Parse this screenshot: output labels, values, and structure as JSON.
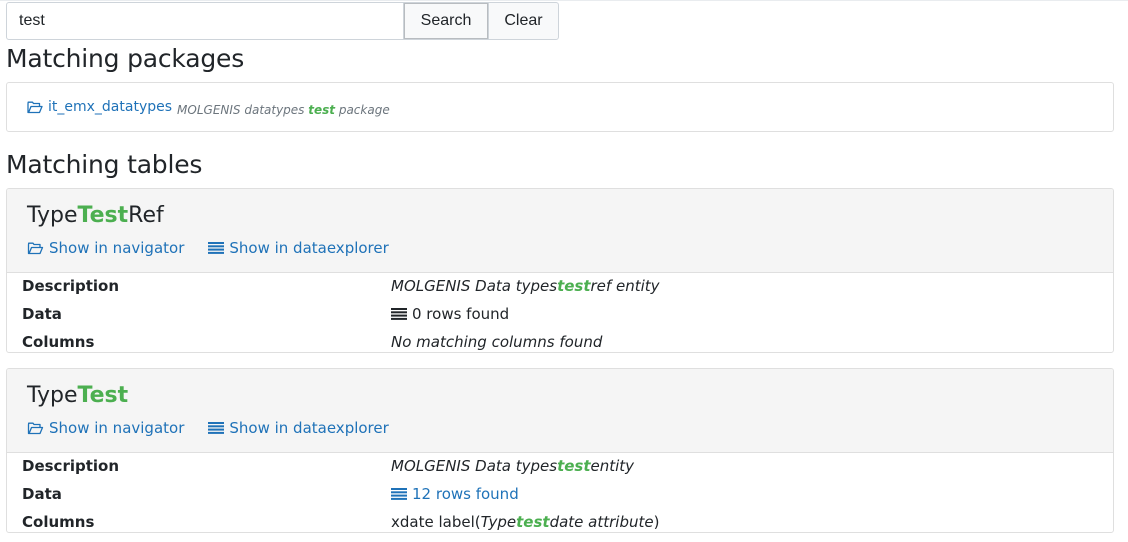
{
  "search": {
    "value": "test",
    "search_label": "Search",
    "clear_label": "Clear"
  },
  "highlight_color": "#4caf50",
  "link_color": "#1f72b8",
  "packages": {
    "title": "Matching packages",
    "items": [
      {
        "name": "it_emx_datatypes",
        "desc_before": "MOLGENIS datatypes ",
        "desc_hl": "test",
        "desc_after": " package",
        "icon": "folder-open-icon"
      }
    ]
  },
  "tables": {
    "title": "Matching tables",
    "show_navigator_label": "Show in navigator",
    "show_dataexplorer_label": "Show in dataexplorer",
    "description_key": "Description",
    "data_key": "Data",
    "columns_key": "Columns",
    "items": [
      {
        "name_before": "Type",
        "name_hl": "Test",
        "name_after": "Ref",
        "desc_before": "MOLGENIS Data types ",
        "desc_hl": "test",
        "desc_after": " ref entity",
        "data_text": "0 rows found",
        "columns_text": "No matching columns found"
      },
      {
        "name_before": "Type",
        "name_hl": "Test",
        "name_after": "",
        "desc_before": "MOLGENIS Data types ",
        "desc_hl": "test",
        "desc_after": " entity",
        "data_text": "12 rows found",
        "columns_before": "xdate label(",
        "columns_it_before": "Type",
        "columns_hl": "test",
        "columns_it_after": " date attribute",
        "columns_after": ")"
      }
    ]
  }
}
